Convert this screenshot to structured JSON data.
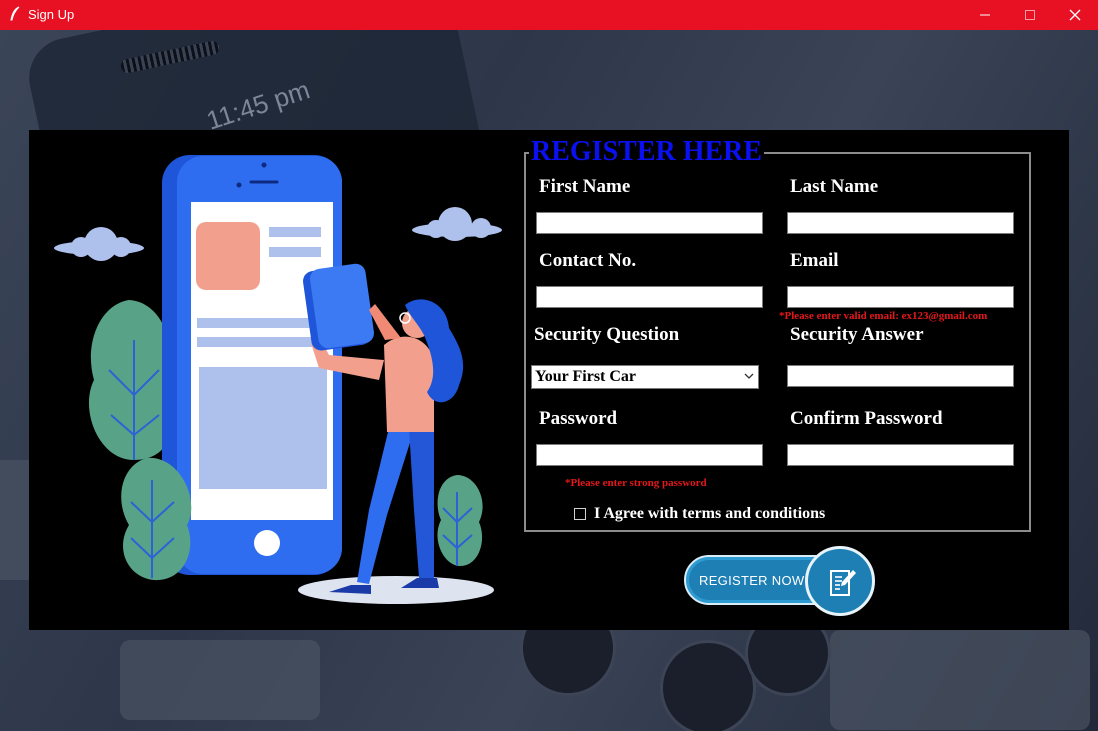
{
  "window": {
    "title": "Sign Up",
    "minimize_label": "Minimize",
    "maximize_label": "Maximize",
    "close_label": "Close"
  },
  "background": {
    "clock_text": "11:45 pm"
  },
  "form": {
    "heading": "REGISTER HERE",
    "first_name": {
      "label": "First Name",
      "value": ""
    },
    "last_name": {
      "label": "Last Name",
      "value": ""
    },
    "contact": {
      "label": "Contact No.",
      "value": ""
    },
    "email": {
      "label": "Email",
      "value": "",
      "error": "*Please enter valid email: ex123@gmail.com"
    },
    "security_question": {
      "label": "Security Question",
      "selected": "Your First Car"
    },
    "security_answer": {
      "label": "Security Answer",
      "value": ""
    },
    "password": {
      "label": "Password",
      "value": "",
      "error": "*Please enter strong password"
    },
    "confirm_password": {
      "label": "Confirm Password",
      "value": ""
    },
    "terms": {
      "label": "I Agree with terms and conditions",
      "checked": false
    },
    "register_button": "REGISTER NOW"
  },
  "colors": {
    "titlebar": "#e81123",
    "heading": "#0a10f0",
    "error": "#e5161b",
    "button": "#1e7fb5"
  }
}
